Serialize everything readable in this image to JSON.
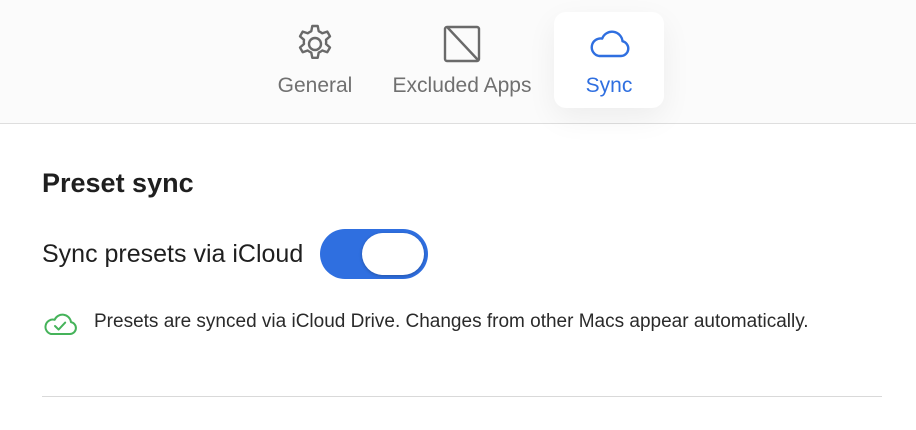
{
  "tabs": [
    {
      "label": "General",
      "icon": "gear-icon",
      "selected": false
    },
    {
      "label": "Excluded Apps",
      "icon": "excluded-apps-icon",
      "selected": false
    },
    {
      "label": "Sync",
      "icon": "cloud-icon",
      "selected": true
    }
  ],
  "section": {
    "title": "Preset sync"
  },
  "sync_toggle": {
    "label": "Sync presets via iCloud",
    "on": true
  },
  "status": {
    "icon": "cloud-checkmark-icon",
    "message": "Presets are synced via iCloud Drive. Changes from other Macs appear automatically."
  },
  "colors": {
    "accent": "#2f6fe0",
    "status_ok": "#45b35a",
    "tab_inactive": "#707070"
  }
}
